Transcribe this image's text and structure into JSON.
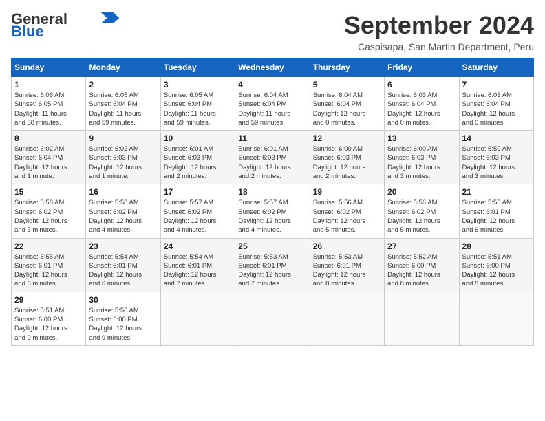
{
  "header": {
    "logo_line1": "General",
    "logo_line2": "Blue",
    "month": "September 2024",
    "location": "Caspisapa, San Martin Department, Peru"
  },
  "weekdays": [
    "Sunday",
    "Monday",
    "Tuesday",
    "Wednesday",
    "Thursday",
    "Friday",
    "Saturday"
  ],
  "weeks": [
    [
      {
        "day": "1",
        "info": "Sunrise: 6:06 AM\nSunset: 6:05 PM\nDaylight: 11 hours\nand 58 minutes."
      },
      {
        "day": "2",
        "info": "Sunrise: 6:05 AM\nSunset: 6:04 PM\nDaylight: 11 hours\nand 59 minutes."
      },
      {
        "day": "3",
        "info": "Sunrise: 6:05 AM\nSunset: 6:04 PM\nDaylight: 11 hours\nand 59 minutes."
      },
      {
        "day": "4",
        "info": "Sunrise: 6:04 AM\nSunset: 6:04 PM\nDaylight: 11 hours\nand 59 minutes."
      },
      {
        "day": "5",
        "info": "Sunrise: 6:04 AM\nSunset: 6:04 PM\nDaylight: 12 hours\nand 0 minutes."
      },
      {
        "day": "6",
        "info": "Sunrise: 6:03 AM\nSunset: 6:04 PM\nDaylight: 12 hours\nand 0 minutes."
      },
      {
        "day": "7",
        "info": "Sunrise: 6:03 AM\nSunset: 6:04 PM\nDaylight: 12 hours\nand 0 minutes."
      }
    ],
    [
      {
        "day": "8",
        "info": "Sunrise: 6:02 AM\nSunset: 6:04 PM\nDaylight: 12 hours\nand 1 minute."
      },
      {
        "day": "9",
        "info": "Sunrise: 6:02 AM\nSunset: 6:03 PM\nDaylight: 12 hours\nand 1 minute."
      },
      {
        "day": "10",
        "info": "Sunrise: 6:01 AM\nSunset: 6:03 PM\nDaylight: 12 hours\nand 2 minutes."
      },
      {
        "day": "11",
        "info": "Sunrise: 6:01 AM\nSunset: 6:03 PM\nDaylight: 12 hours\nand 2 minutes."
      },
      {
        "day": "12",
        "info": "Sunrise: 6:00 AM\nSunset: 6:03 PM\nDaylight: 12 hours\nand 2 minutes."
      },
      {
        "day": "13",
        "info": "Sunrise: 6:00 AM\nSunset: 6:03 PM\nDaylight: 12 hours\nand 3 minutes."
      },
      {
        "day": "14",
        "info": "Sunrise: 5:59 AM\nSunset: 6:03 PM\nDaylight: 12 hours\nand 3 minutes."
      }
    ],
    [
      {
        "day": "15",
        "info": "Sunrise: 5:58 AM\nSunset: 6:02 PM\nDaylight: 12 hours\nand 3 minutes."
      },
      {
        "day": "16",
        "info": "Sunrise: 5:58 AM\nSunset: 6:02 PM\nDaylight: 12 hours\nand 4 minutes."
      },
      {
        "day": "17",
        "info": "Sunrise: 5:57 AM\nSunset: 6:02 PM\nDaylight: 12 hours\nand 4 minutes."
      },
      {
        "day": "18",
        "info": "Sunrise: 5:57 AM\nSunset: 6:02 PM\nDaylight: 12 hours\nand 4 minutes."
      },
      {
        "day": "19",
        "info": "Sunrise: 5:56 AM\nSunset: 6:02 PM\nDaylight: 12 hours\nand 5 minutes."
      },
      {
        "day": "20",
        "info": "Sunrise: 5:56 AM\nSunset: 6:02 PM\nDaylight: 12 hours\nand 5 minutes."
      },
      {
        "day": "21",
        "info": "Sunrise: 5:55 AM\nSunset: 6:01 PM\nDaylight: 12 hours\nand 6 minutes."
      }
    ],
    [
      {
        "day": "22",
        "info": "Sunrise: 5:55 AM\nSunset: 6:01 PM\nDaylight: 12 hours\nand 6 minutes."
      },
      {
        "day": "23",
        "info": "Sunrise: 5:54 AM\nSunset: 6:01 PM\nDaylight: 12 hours\nand 6 minutes."
      },
      {
        "day": "24",
        "info": "Sunrise: 5:54 AM\nSunset: 6:01 PM\nDaylight: 12 hours\nand 7 minutes."
      },
      {
        "day": "25",
        "info": "Sunrise: 5:53 AM\nSunset: 6:01 PM\nDaylight: 12 hours\nand 7 minutes."
      },
      {
        "day": "26",
        "info": "Sunrise: 5:53 AM\nSunset: 6:01 PM\nDaylight: 12 hours\nand 8 minutes."
      },
      {
        "day": "27",
        "info": "Sunrise: 5:52 AM\nSunset: 6:00 PM\nDaylight: 12 hours\nand 8 minutes."
      },
      {
        "day": "28",
        "info": "Sunrise: 5:51 AM\nSunset: 6:00 PM\nDaylight: 12 hours\nand 8 minutes."
      }
    ],
    [
      {
        "day": "29",
        "info": "Sunrise: 5:51 AM\nSunset: 6:00 PM\nDaylight: 12 hours\nand 9 minutes."
      },
      {
        "day": "30",
        "info": "Sunrise: 5:50 AM\nSunset: 6:00 PM\nDaylight: 12 hours\nand 9 minutes."
      },
      {
        "day": "",
        "info": ""
      },
      {
        "day": "",
        "info": ""
      },
      {
        "day": "",
        "info": ""
      },
      {
        "day": "",
        "info": ""
      },
      {
        "day": "",
        "info": ""
      }
    ]
  ]
}
